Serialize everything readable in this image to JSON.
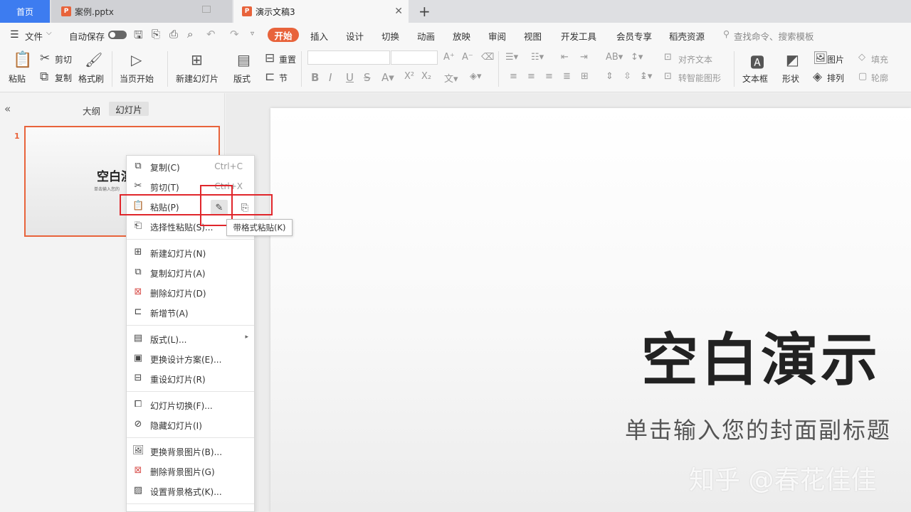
{
  "tabs": {
    "home": "首页",
    "case_file": "案例.pptx",
    "current_doc": "演示文稿3",
    "close_glyph": "✕",
    "add_glyph": "+",
    "ppt_glyph": "P"
  },
  "menubar": {
    "file": "文件",
    "autosave": "自动保存",
    "items": [
      "开始",
      "插入",
      "设计",
      "切换",
      "动画",
      "放映",
      "审阅",
      "视图",
      "开发工具",
      "会员专享",
      "稻壳资源"
    ],
    "search_placeholder": "查找命令、搜索模板"
  },
  "ribbon": {
    "paste": "粘贴",
    "cut": "剪切",
    "copy": "复制",
    "format_painter": "格式刷",
    "from_start": "当页开始",
    "new_slide": "新建幻灯片",
    "layout": "版式",
    "section": "节",
    "reset": "重置",
    "align_text": "对齐文本",
    "smart_graphic": "转智能图形",
    "textbox": "文本框",
    "shape": "形状",
    "picture": "图片",
    "arrange": "排列",
    "fill": "填充",
    "outline": "轮廓",
    "format_buttons": [
      "B",
      "I",
      "U",
      "S"
    ]
  },
  "left_pane": {
    "outline_tab": "大纲",
    "slides_tab": "幻灯片",
    "collapse_glyph": "«",
    "slide_number": "1",
    "thumb_title": "空白演",
    "thumb_subtitle": "单击输入您的"
  },
  "context_menu": {
    "copy": {
      "label": "复制(C)",
      "shortcut": "Ctrl+C"
    },
    "cut": {
      "label": "剪切(T)",
      "shortcut": "Ctrl+X"
    },
    "paste": {
      "label": "粘贴(P)"
    },
    "paste_special": {
      "label": "选择性粘贴(S)..."
    },
    "new_slide": {
      "label": "新建幻灯片(N)"
    },
    "duplicate_slide": {
      "label": "复制幻灯片(A)"
    },
    "delete_slide": {
      "label": "删除幻灯片(D)"
    },
    "add_section": {
      "label": "新增节(A)"
    },
    "layout": {
      "label": "版式(L)...",
      "arrow": "▸"
    },
    "change_design": {
      "label": "更换设计方案(E)..."
    },
    "reset_slide": {
      "label": "重设幻灯片(R)"
    },
    "transition": {
      "label": "幻灯片切换(F)..."
    },
    "hide_slide": {
      "label": "隐藏幻灯片(I)"
    },
    "change_bg": {
      "label": "更换背景图片(B)..."
    },
    "delete_bg": {
      "label": "删除背景图片(G)"
    },
    "bg_format": {
      "label": "设置背景格式(K)..."
    }
  },
  "tooltip": "带格式粘贴(K)",
  "slide": {
    "title": "空白演示",
    "subtitle": "单击输入您的封面副标题"
  },
  "watermark": "知乎 @春花佳佳",
  "colors": {
    "accent": "#e8633b",
    "tab_blue": "#3d7cf0",
    "highlight_red": "#e0262b"
  }
}
